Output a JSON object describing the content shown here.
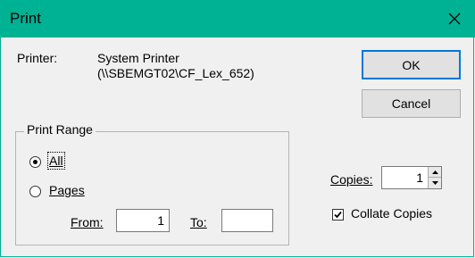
{
  "window": {
    "title": "Print"
  },
  "printer": {
    "label": "Printer:",
    "name_line1": "System Printer",
    "name_line2": "(\\\\SBEMGT02\\CF_Lex_652)"
  },
  "buttons": {
    "ok": "OK",
    "cancel": "Cancel"
  },
  "print_range": {
    "legend": "Print Range",
    "all_label": "All",
    "pages_label": "Pages",
    "selected": "All",
    "from_label": "From:",
    "from_value": "1",
    "to_label": "To:",
    "to_value": ""
  },
  "copies": {
    "label": "Copies:",
    "value": "1"
  },
  "collate": {
    "label": "Collate Copies",
    "checked": true
  },
  "icons": [
    "close-icon",
    "spin-up-icon",
    "spin-down-icon",
    "checkmark-icon"
  ],
  "colors": {
    "title_bar": "#00b294",
    "default_button_border": "#0078d7"
  }
}
